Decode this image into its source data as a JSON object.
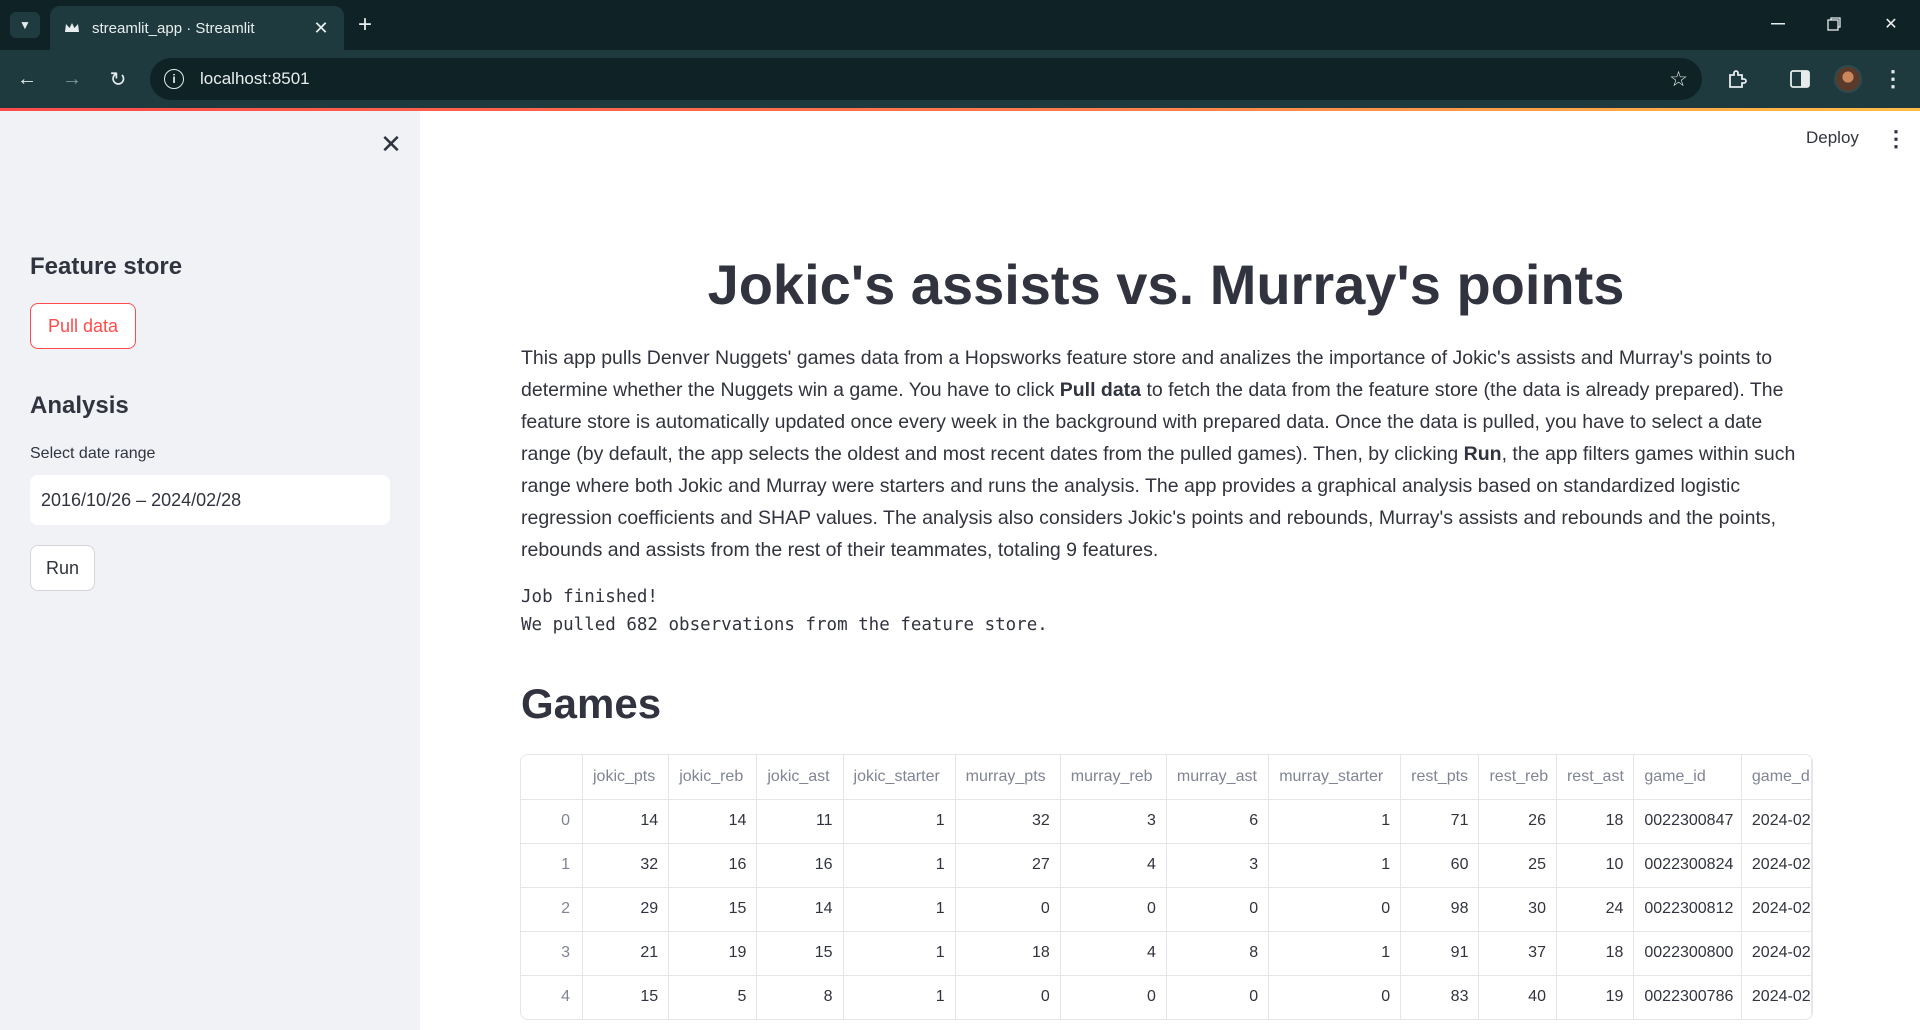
{
  "browser": {
    "tab_title": "streamlit_app · Streamlit",
    "url": "localhost:8501"
  },
  "sidebar": {
    "feature_store_heading": "Feature store",
    "pull_button": "Pull data",
    "analysis_heading": "Analysis",
    "date_label": "Select date range",
    "date_value": "2016/10/26 – 2024/02/28",
    "run_button": "Run"
  },
  "header": {
    "deploy_label": "Deploy"
  },
  "main": {
    "title": "Jokic's assists vs. Murray's points",
    "description": {
      "part1": "This app pulls Denver Nuggets' games data from a Hopsworks feature store and analizes the importance of Jokic's assists and Murray's points to determine whether the Nuggets win a game. You have to click ",
      "bold1": "Pull data",
      "part2": " to fetch the data from the feature store (the data is already prepared). The feature store is automatically updated once every week in the background with prepared data. Once the data is pulled, you have to select a date range (by default, the app selects the oldest and most recent dates from the pulled games). Then, by clicking ",
      "bold2": "Run",
      "part3": ", the app filters games within such range where both Jokic and Murray were starters and runs the analysis. The app provides a graphical analysis based on standardized logistic regression coefficients and SHAP values. The analysis also considers Jokic's points and rebounds, Murray's assists and rebounds and the points, rebounds and assists from the rest of their teammates, totaling 9 features."
    },
    "status_line1": "Job finished!",
    "status_line2": "We pulled 682 observations from the feature store.",
    "games_heading": "Games",
    "table": {
      "columns": [
        "jokic_pts",
        "jokic_reb",
        "jokic_ast",
        "jokic_starter",
        "murray_pts",
        "murray_reb",
        "murray_ast",
        "murray_starter",
        "rest_pts",
        "rest_reb",
        "rest_ast",
        "game_id",
        "game_d"
      ],
      "rows": [
        {
          "idx": "0",
          "cells": [
            "14",
            "14",
            "11",
            "1",
            "32",
            "3",
            "6",
            "1",
            "71",
            "26",
            "18",
            "0022300847",
            "2024-02"
          ]
        },
        {
          "idx": "1",
          "cells": [
            "32",
            "16",
            "16",
            "1",
            "27",
            "4",
            "3",
            "1",
            "60",
            "25",
            "10",
            "0022300824",
            "2024-02"
          ]
        },
        {
          "idx": "2",
          "cells": [
            "29",
            "15",
            "14",
            "1",
            "0",
            "0",
            "0",
            "0",
            "98",
            "30",
            "24",
            "0022300812",
            "2024-02"
          ]
        },
        {
          "idx": "3",
          "cells": [
            "21",
            "19",
            "15",
            "1",
            "18",
            "4",
            "8",
            "1",
            "91",
            "37",
            "18",
            "0022300800",
            "2024-02"
          ]
        },
        {
          "idx": "4",
          "cells": [
            "15",
            "5",
            "8",
            "1",
            "0",
            "0",
            "0",
            "0",
            "83",
            "40",
            "19",
            "0022300786",
            "2024-02"
          ]
        }
      ]
    }
  }
}
